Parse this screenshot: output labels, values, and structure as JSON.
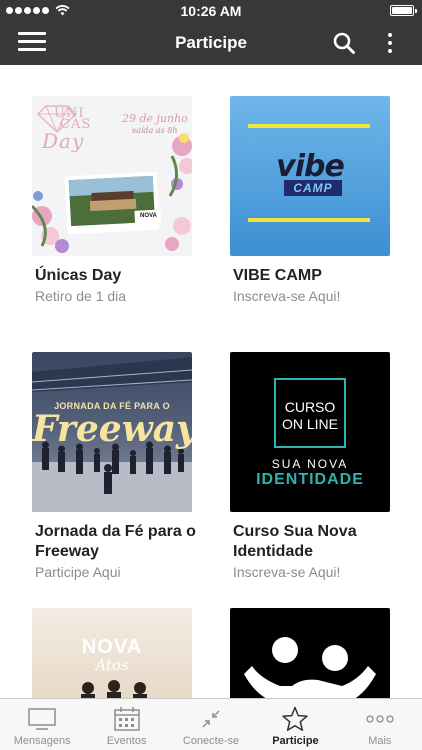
{
  "status_bar": {
    "time": "10:26 AM"
  },
  "nav": {
    "title": "Participe"
  },
  "cards": [
    {
      "title": "Únicas Day",
      "subtitle": "Retiro de 1 dia",
      "thumb": {
        "logo_line1": "ÚNI",
        "logo_line2": "CAS",
        "logo_line3": "Day",
        "date": "29 de junho",
        "time": "saída as 8h",
        "brand": "NOVA"
      }
    },
    {
      "title": "VIBE CAMP",
      "subtitle": "Inscreva-se Aqui!",
      "thumb": {
        "logo_top": "vibe",
        "logo_bottom": "CAMP"
      }
    },
    {
      "title": "Jornada da Fé para o Freeway",
      "subtitle": "Participe Aqui",
      "thumb": {
        "line1": "JORNADA DA FÉ PARA O",
        "line2": "Freeway"
      }
    },
    {
      "title": "Curso Sua Nova Identidade",
      "subtitle": "Inscreva-se Aqui!",
      "thumb": {
        "box_line1": "CURSO",
        "box_line2": "ON LINE",
        "line3": "SUA NOVA",
        "line4": "IDENTIDADE"
      }
    },
    {
      "title": "",
      "subtitle": "",
      "thumb": {
        "brand": "NOVA",
        "brand_sub": "Atos"
      }
    },
    {
      "title": "",
      "subtitle": "",
      "thumb": {}
    }
  ],
  "tabs": [
    {
      "label": "Mensagens",
      "icon": "tv-icon",
      "active": false
    },
    {
      "label": "Eventos",
      "icon": "calendar-icon",
      "active": false
    },
    {
      "label": "Conecte-se",
      "icon": "connect-icon",
      "active": false
    },
    {
      "label": "Participe",
      "icon": "star-icon",
      "active": true
    },
    {
      "label": "Mais",
      "icon": "more-dots-icon",
      "active": false
    }
  ],
  "colors": {
    "bar": "#383838",
    "accent_yellow": "#f0e53a",
    "teal": "#2fb3b0"
  }
}
